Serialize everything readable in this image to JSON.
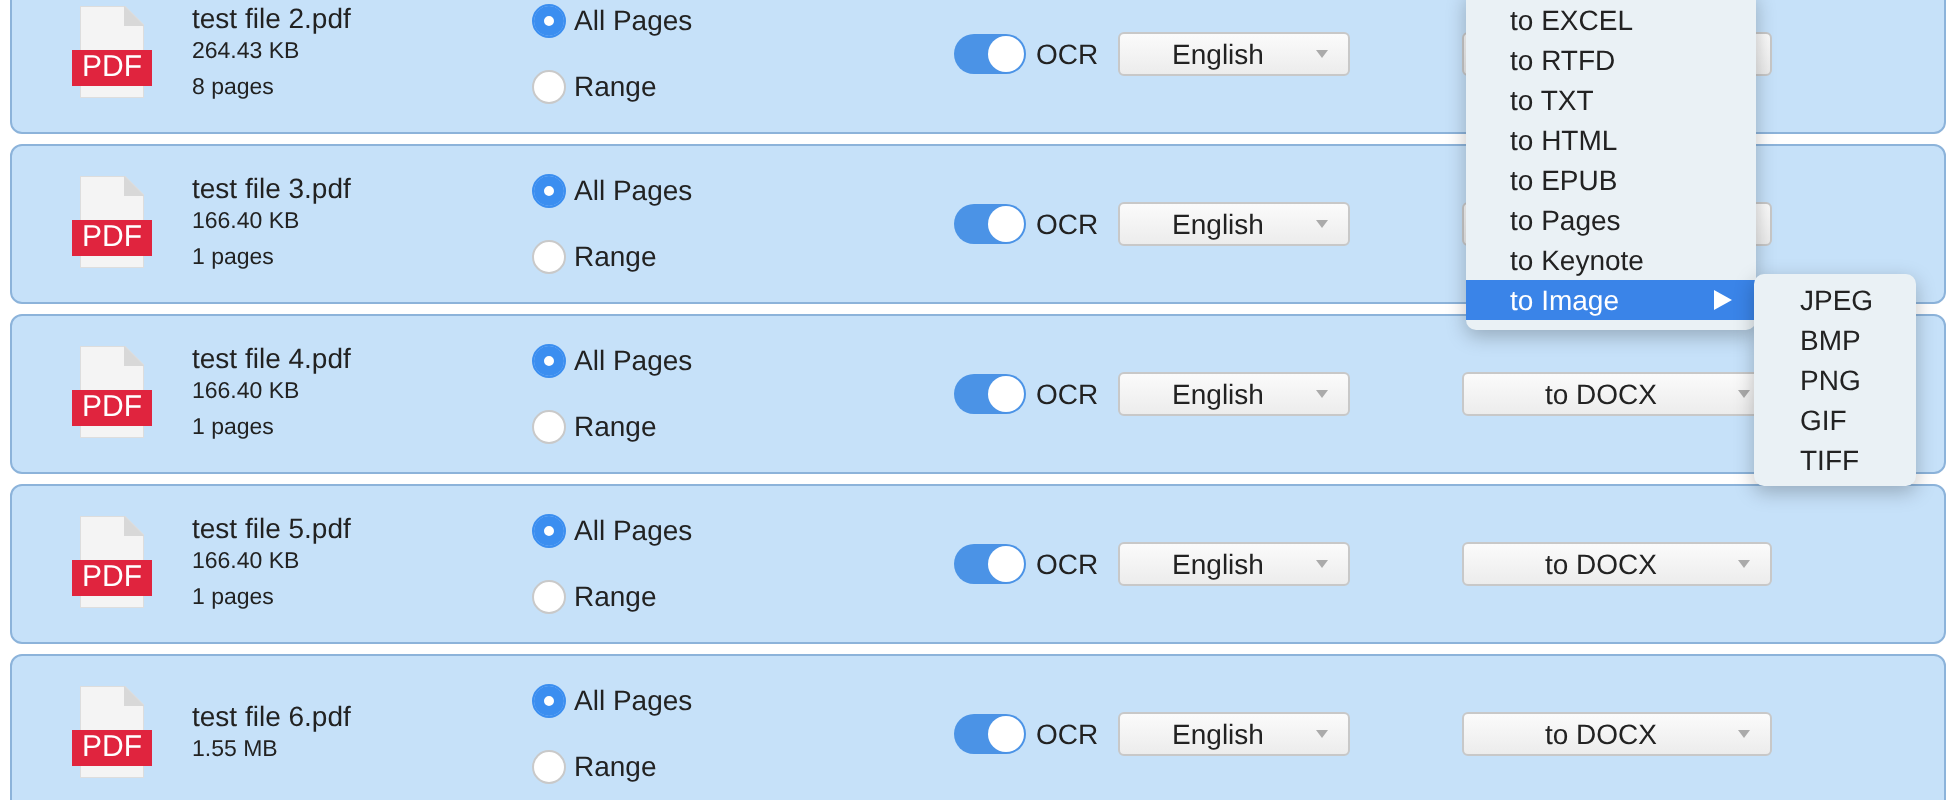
{
  "files": [
    {
      "name": "test file 2.pdf",
      "badge": "PDF",
      "size": "264.43 KB",
      "pages": "8 pages",
      "page_options": [
        {
          "label": "All Pages",
          "selected": true
        },
        {
          "label": "Range",
          "selected": false
        }
      ],
      "ocr": {
        "label": "OCR",
        "on": true
      },
      "language": "English"
    },
    {
      "name": "test file 3.pdf",
      "badge": "PDF",
      "size": "166.40 KB",
      "pages": "1 pages",
      "page_options": [
        {
          "label": "All Pages",
          "selected": true
        },
        {
          "label": "Range",
          "selected": false
        }
      ],
      "ocr": {
        "label": "OCR",
        "on": true
      },
      "language": "English"
    },
    {
      "name": "test file 4.pdf",
      "badge": "PDF",
      "size": "166.40 KB",
      "pages": "1 pages",
      "page_options": [
        {
          "label": "All Pages",
          "selected": true
        },
        {
          "label": "Range",
          "selected": false
        }
      ],
      "ocr": {
        "label": "OCR",
        "on": true
      },
      "language": "English",
      "format": "to DOCX"
    },
    {
      "name": "test file 5.pdf",
      "badge": "PDF",
      "size": "166.40 KB",
      "pages": "1 pages",
      "page_options": [
        {
          "label": "All Pages",
          "selected": true
        },
        {
          "label": "Range",
          "selected": false
        }
      ],
      "ocr": {
        "label": "OCR",
        "on": true
      },
      "language": "English",
      "format": "to DOCX"
    },
    {
      "name": "test file 6.pdf",
      "badge": "PDF",
      "size": "1.55 MB",
      "page_options": [
        {
          "label": "All Pages",
          "selected": true
        },
        {
          "label": "Range",
          "selected": false
        }
      ],
      "ocr": {
        "label": "OCR",
        "on": true
      },
      "language": "English",
      "format": "to DOCX"
    }
  ],
  "format_menu": {
    "items": [
      {
        "label": "to EXCEL",
        "selected": false
      },
      {
        "label": "to RTFD",
        "selected": false
      },
      {
        "label": "to TXT",
        "selected": false
      },
      {
        "label": "to HTML",
        "selected": false
      },
      {
        "label": "to EPUB",
        "selected": false
      },
      {
        "label": "to Pages",
        "selected": false
      },
      {
        "label": "to Keynote",
        "selected": false
      },
      {
        "label": "to Image",
        "selected": true,
        "kind": "submenu"
      }
    ],
    "submenu": [
      "JPEG",
      "BMP",
      "PNG",
      "GIF",
      "TIFF"
    ]
  }
}
